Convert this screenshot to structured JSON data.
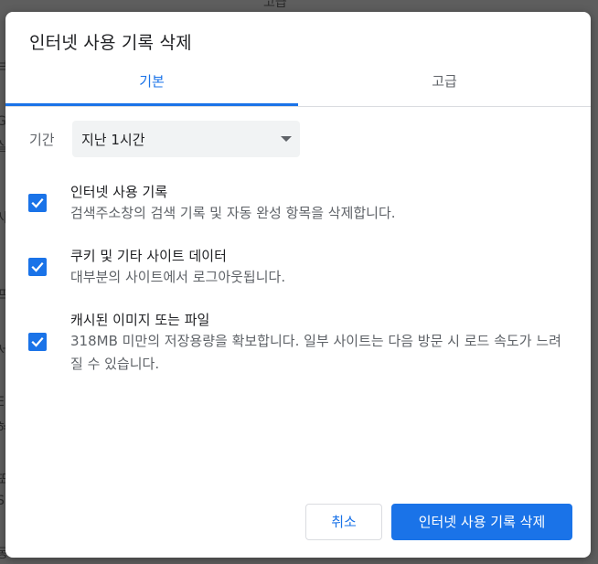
{
  "background": {
    "top_text": "고급",
    "left_fragments": [
      "브",
      "G",
      "실",
      "사",
      "프",
      "서",
      "E",
      "혀",
      "또",
      "SI",
      "동"
    ]
  },
  "dialog": {
    "title": "인터넷 사용 기록 삭제",
    "tabs": [
      {
        "label": "기본",
        "active": true
      },
      {
        "label": "고급",
        "active": false
      }
    ],
    "period": {
      "label": "기간",
      "selected": "지난 1시간"
    },
    "options": [
      {
        "title": "인터넷 사용 기록",
        "description": "검색주소창의 검색 기록 및 자동 완성 항목을 삭제합니다.",
        "checked": true
      },
      {
        "title": "쿠키 및 기타 사이트 데이터",
        "description": "대부분의 사이트에서 로그아웃됩니다.",
        "checked": true
      },
      {
        "title": "캐시된 이미지 또는 파일",
        "description": "318MB 미만의 저장용량을 확보합니다. 일부 사이트는 다음 방문 시 로드 속도가 느려질 수 있습니다.",
        "checked": true
      }
    ],
    "buttons": {
      "cancel": "취소",
      "confirm": "인터넷 사용 기록 삭제"
    }
  },
  "colors": {
    "accent": "#1a73e8",
    "text_primary": "#202124",
    "text_secondary": "#5f6368",
    "select_bg": "#f1f3f4"
  },
  "icons": {
    "checkbox": "checkmark-icon",
    "dropdown": "dropdown-arrow-icon"
  }
}
